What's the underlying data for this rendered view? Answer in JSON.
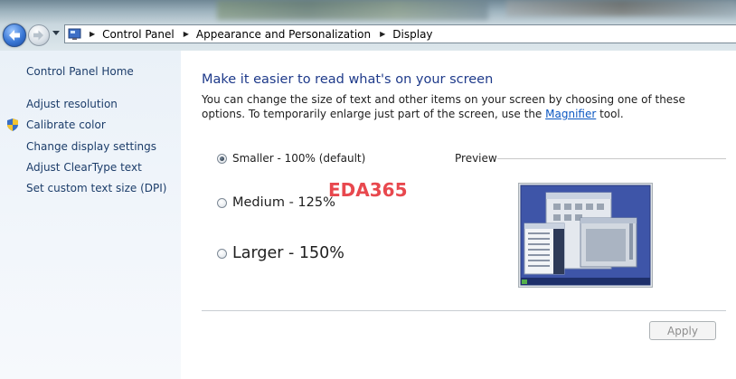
{
  "address_bar": {
    "breadcrumbs": [
      "Control Panel",
      "Appearance and Personalization",
      "Display"
    ],
    "icons": {
      "back": "back-arrow-icon",
      "forward": "forward-arrow-icon",
      "history": "chevron-down-icon",
      "location": "control-panel-icon",
      "separator": "chevron-right-icon"
    }
  },
  "sidebar": {
    "home_label": "Control Panel Home",
    "items": [
      {
        "label": "Adjust resolution",
        "icon": null
      },
      {
        "label": "Calibrate color",
        "icon": "uac-shield-icon"
      },
      {
        "label": "Change display settings",
        "icon": null
      },
      {
        "label": "Adjust ClearType text",
        "icon": null
      },
      {
        "label": "Set custom text size (DPI)",
        "icon": null
      }
    ]
  },
  "main": {
    "title": "Make it easier to read what's on your screen",
    "description_before_link": "You can change the size of text and other items on your screen by choosing one of these options. To temporarily enlarge just part of the screen, use the ",
    "link_text": "Magnifier",
    "description_after_link": " tool.",
    "options": [
      {
        "label": "Smaller - 100% (default)",
        "selected": true
      },
      {
        "label": "Medium - 125%",
        "selected": false
      },
      {
        "label": "Larger - 150%",
        "selected": false
      }
    ],
    "preview_label": "Preview",
    "watermark": "EDA365",
    "apply_label": "Apply",
    "apply_enabled": false
  },
  "colors": {
    "link": "#0b57c2",
    "title": "#1e3a8a",
    "sidebar_text": "#1c3d6a",
    "watermark": "#e8484e"
  }
}
